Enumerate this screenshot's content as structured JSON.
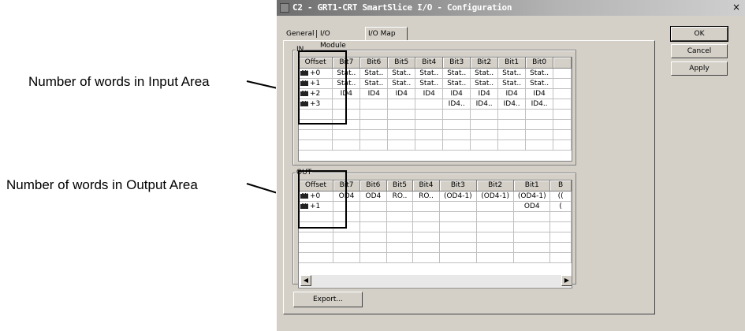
{
  "annotations": {
    "input": "Number of words in Input Area",
    "output": "Number of words in Output Area"
  },
  "window": {
    "title": "C2 - GRT1-CRT SmartSlice I/O - Configuration",
    "close": "×"
  },
  "tabs": [
    "General",
    "I/O Module",
    "I/O Map"
  ],
  "buttons": {
    "ok": "OK",
    "cancel": "Cancel",
    "apply": "Apply",
    "export": "Export..."
  },
  "in_group": {
    "label": "IN",
    "headers": [
      "Offset",
      "Bit7",
      "Bit6",
      "Bit5",
      "Bit4",
      "Bit3",
      "Bit2",
      "Bit1",
      "Bit0",
      ""
    ],
    "rows": [
      [
        "+0",
        "Stat..",
        "Stat..",
        "Stat..",
        "Stat..",
        "Stat..",
        "Stat..",
        "Stat..",
        "Stat..",
        ""
      ],
      [
        "+1",
        "Stat..",
        "Stat..",
        "Stat..",
        "Stat..",
        "Stat..",
        "Stat..",
        "Stat..",
        "Stat..",
        ""
      ],
      [
        "+2",
        "ID4",
        "ID4",
        "ID4",
        "ID4",
        "ID4",
        "ID4",
        "ID4",
        "ID4",
        ""
      ],
      [
        "+3",
        "",
        "",
        "",
        "",
        "ID4..",
        "ID4..",
        "ID4..",
        "ID4..",
        ""
      ]
    ]
  },
  "out_group": {
    "label": "OUT",
    "headers": [
      "Offset",
      "Bit7",
      "Bit6",
      "Bit5",
      "Bit4",
      "Bit3",
      "Bit2",
      "Bit1",
      "B"
    ],
    "rows": [
      [
        "+0",
        "OD4",
        "OD4",
        "RO..",
        "RO..",
        "(OD4-1)",
        "(OD4-1)",
        "(OD4-1)",
        "(("
      ],
      [
        "+1",
        "",
        "",
        "",
        "",
        "",
        "",
        "OD4",
        "("
      ]
    ]
  },
  "scrollbar": {
    "left": "◀",
    "right": "▶"
  }
}
